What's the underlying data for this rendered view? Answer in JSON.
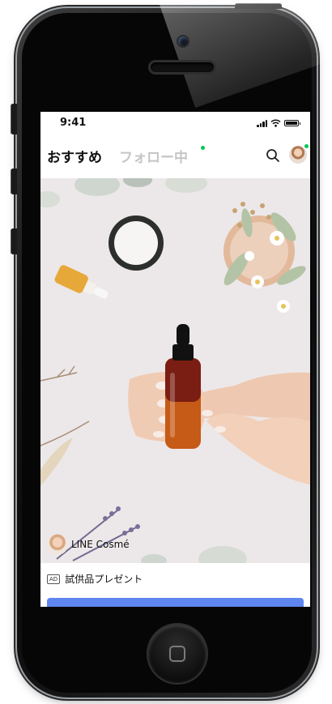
{
  "status_bar": {
    "time": "9:41"
  },
  "header": {
    "tab_recommended": "おすすめ",
    "tab_following": "フォロー中",
    "search_icon": "search-icon",
    "accent_color": "#06c755"
  },
  "post": {
    "account_name": "LINE Cosmé",
    "ad_badge": "AD",
    "caption": "試供品プレゼント",
    "button_color": "#5f86f0"
  }
}
